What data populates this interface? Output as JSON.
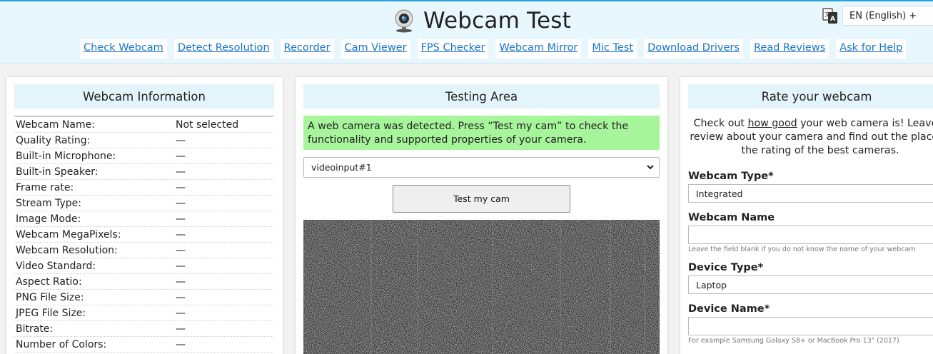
{
  "header": {
    "title": "Webcam Test",
    "language": "EN (English) +",
    "nav": [
      "Check Webcam",
      "Detect Resolution",
      "Recorder",
      "Cam Viewer",
      "FPS Checker",
      "Webcam Mirror",
      "Mic Test",
      "Download Drivers",
      "Read Reviews",
      "Ask for Help"
    ]
  },
  "info": {
    "title": "Webcam Information",
    "rows": [
      {
        "label": "Webcam Name:",
        "value": "Not selected"
      },
      {
        "label": "Quality Rating:",
        "value": "—"
      },
      {
        "label": "Built-in Microphone:",
        "value": "—"
      },
      {
        "label": "Built-in Speaker:",
        "value": "—"
      },
      {
        "label": "Frame rate:",
        "value": "—"
      },
      {
        "label": "Stream Type:",
        "value": "—"
      },
      {
        "label": "Image Mode:",
        "value": "—"
      },
      {
        "label": "Webcam MegaPixels:",
        "value": "—"
      },
      {
        "label": "Webcam Resolution:",
        "value": "—"
      },
      {
        "label": "Video Standard:",
        "value": "—"
      },
      {
        "label": "Aspect Ratio:",
        "value": "—"
      },
      {
        "label": "PNG File Size:",
        "value": "—"
      },
      {
        "label": "JPEG File Size:",
        "value": "—"
      },
      {
        "label": "Bitrate:",
        "value": "—"
      },
      {
        "label": "Number of Colors:",
        "value": "—"
      }
    ]
  },
  "testing": {
    "title": "Testing Area",
    "notice": "A web camera was detected. Press “Test my cam” to check the functionality and supported properties of your camera.",
    "device": "videoinput#1",
    "button": "Test my cam"
  },
  "rate": {
    "title": "Rate your webcam",
    "intro_pre": "Check out ",
    "intro_link": "how good",
    "intro_post": " your web camera is! Leave a review about your camera and find out the place in the rating of the best cameras.",
    "type_label": "Webcam Type*",
    "type_value": "Integrated",
    "name_label": "Webcam Name",
    "name_value": "",
    "name_hint": "Leave the field blank if you do not know the name of your webcam",
    "device_type_label": "Device Type*",
    "device_type_value": "Laptop",
    "device_name_label": "Device Name*",
    "device_name_value": "",
    "device_name_hint": "For example Samsung Galaxy S8+ or MacBook Pro 13\" (2017)"
  },
  "colors": {
    "accent": "#2aa3dc",
    "header_bg": "#e8f6fd",
    "link": "#1a73c9",
    "notice_bg": "#a6f59a",
    "title_bg": "#e4f4fb"
  },
  "icons": {
    "logo": "webcam-icon",
    "language": "translate-icon",
    "select": "chevron-down-icon"
  }
}
